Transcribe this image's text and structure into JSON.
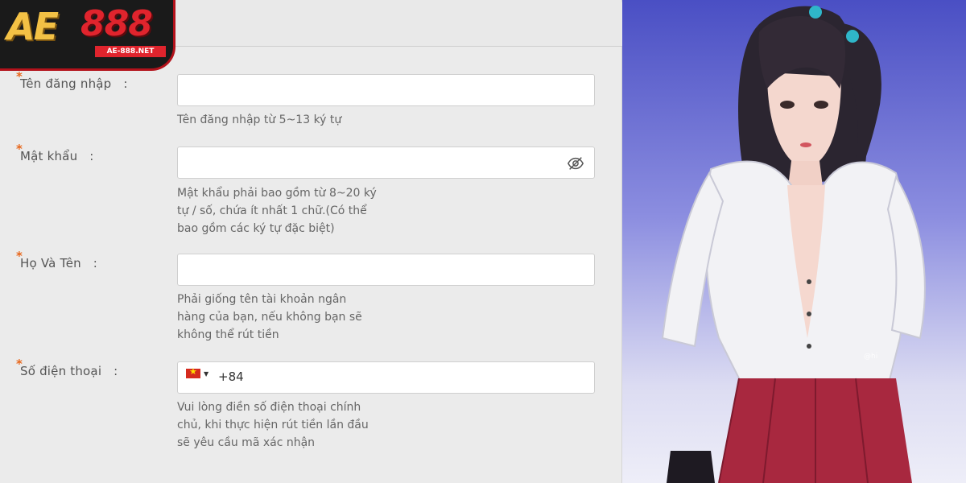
{
  "brand": {
    "logo_main": "AE",
    "logo_number": "888",
    "logo_domain": "AE-888.NET"
  },
  "form": {
    "required_mark": "*",
    "username": {
      "label": "Tên đăng nhập",
      "colon": ":",
      "value": "",
      "hint": "Tên đăng nhập từ 5~13 ký tự"
    },
    "password": {
      "label": "Mật khẩu",
      "colon": ":",
      "value": "",
      "hint": "Mật khẩu phải bao gồm từ 8~20 ký tự / số, chứa ít nhất 1 chữ.(Có thể bao gồm các ký tự đặc biệt)"
    },
    "fullname": {
      "label": "Họ Và Tên",
      "colon": ":",
      "value": "",
      "hint": "Phải giống tên tài khoản ngân hàng của bạn, nếu không bạn sẽ không thể rút tiền"
    },
    "phone": {
      "label": "Số điện thoại",
      "colon": ":",
      "country_code": "+84",
      "hint": "Vui lòng điền số điện thoại chính chủ, khi thực hiện rút tiền lần đầu sẽ yêu cầu mã xác nhận"
    }
  },
  "art": {
    "watermark": "@hi"
  },
  "colors": {
    "panel_bg": "#ebebeb",
    "required_star": "#e8661a",
    "brand_gold": "#f3c145",
    "brand_red": "#e0242d"
  }
}
